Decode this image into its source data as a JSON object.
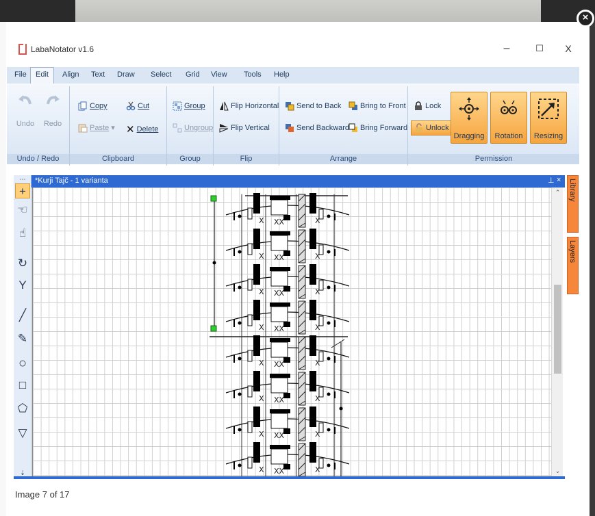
{
  "lightbox": {
    "close_glyph": "×",
    "caption": "Image 7 of 17"
  },
  "app": {
    "title": "LabaNotator v1.6",
    "window_buttons": {
      "minimize": "–",
      "maximize": "☐",
      "close": "X"
    }
  },
  "menu": [
    "File",
    "Edit",
    "Align",
    "Text",
    "Draw",
    "Select",
    "Grid",
    "View",
    "Tools",
    "Help"
  ],
  "menu_active": "Edit",
  "ribbon": {
    "undo_redo": {
      "label": "Undo / Redo",
      "undo": "Undo",
      "redo": "Redo"
    },
    "clipboard": {
      "label": "Clipboard",
      "copy": "Copy",
      "paste": "Paste",
      "cut": "Cut",
      "delete": "Delete"
    },
    "group": {
      "label": "Group",
      "group": "Group",
      "ungroup": "Ungroup"
    },
    "flip": {
      "label": "Flip",
      "horizontal": "Flip Horizontal",
      "vertical": "Flip Vertical"
    },
    "arrange": {
      "label": "Arrange",
      "send_back": "Send to Back",
      "send_backward": "Send Backward",
      "bring_front": "Bring to Front",
      "bring_forward": "Bring Forward"
    },
    "permission": {
      "label": "Permission",
      "lock": "Lock",
      "unlock": "Unlock",
      "dragging": "Dragging",
      "rotation": "Rotation",
      "resizing": "Resizing"
    }
  },
  "document": {
    "title": "*Kurji Tajč - 1 varianta",
    "pin": "⊥",
    "close": "×"
  },
  "side_tabs": {
    "library": "Library",
    "layers": "Layers"
  },
  "colors": {
    "accent": "#2f6ad3",
    "ribbon_bg": "#dae6f4",
    "active_toggle": "#f6a43e",
    "side_tab": "#f5863a"
  }
}
